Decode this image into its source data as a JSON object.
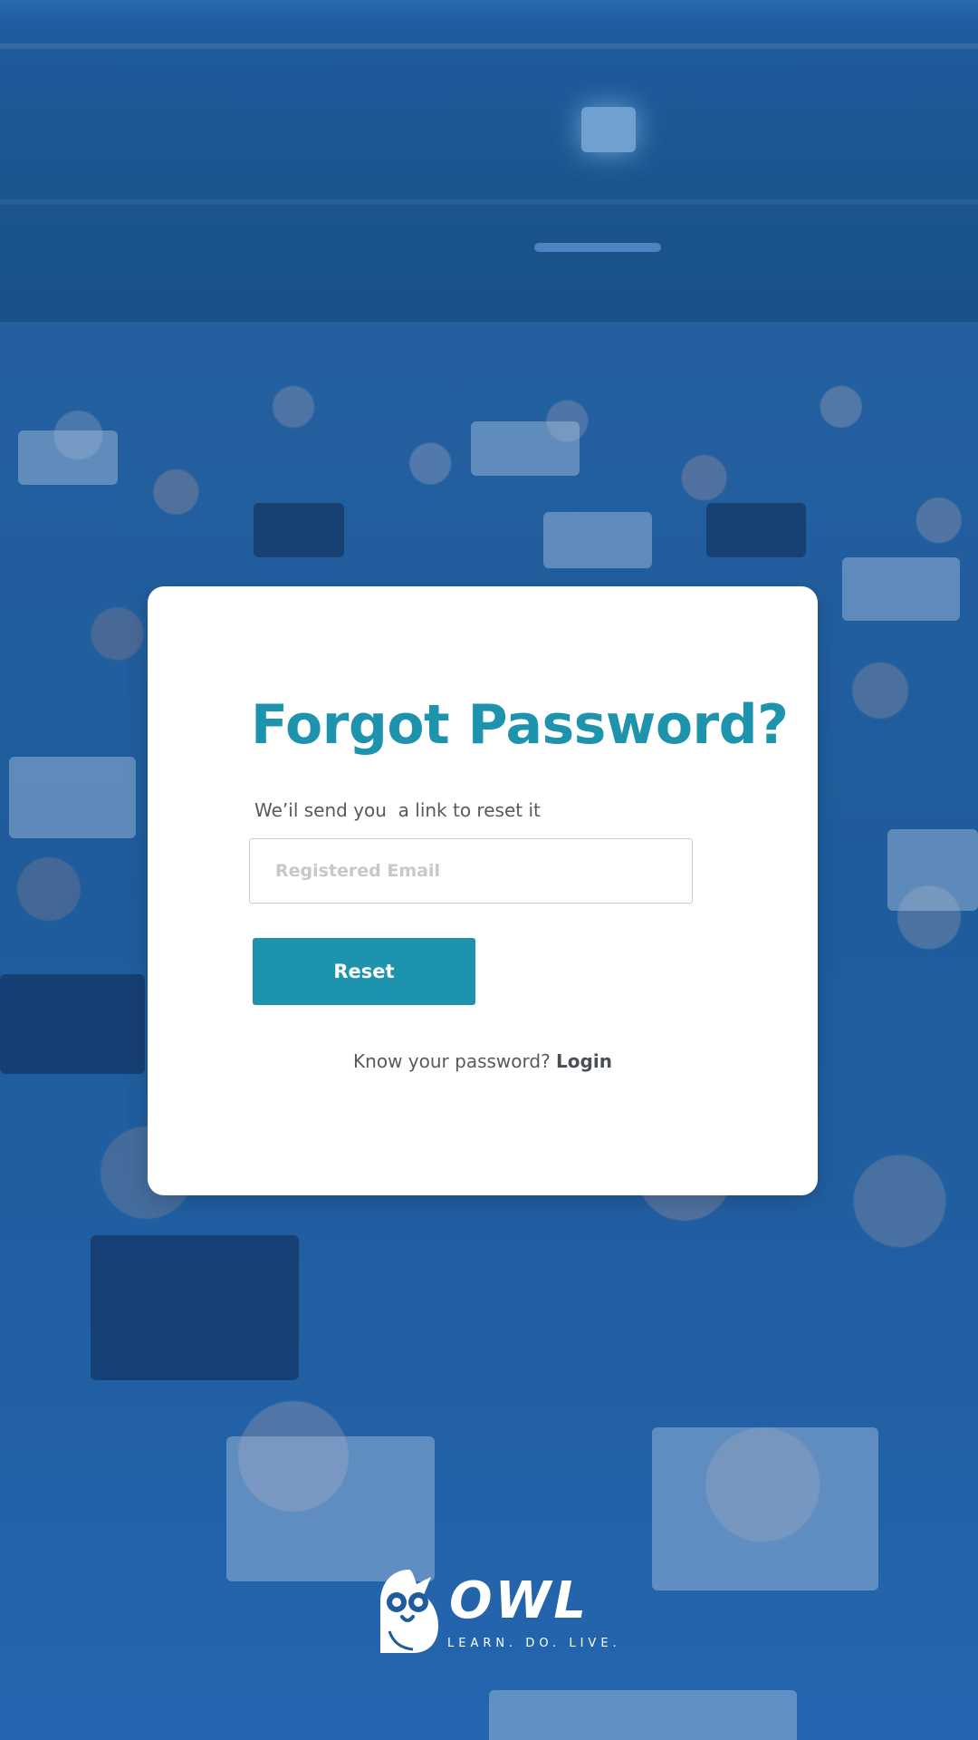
{
  "card": {
    "title": "Forgot Password?",
    "subtitle": "We’il send you  a link to reset it",
    "email_placeholder": "Registered Email",
    "email_value": "",
    "reset_label": "Reset",
    "login_prompt": "Know your password?",
    "login_label": "Login"
  },
  "brand": {
    "name": "OWL",
    "tagline": "LEARN. DO. LIVE.",
    "logo_icon": "owl-icon"
  },
  "colors": {
    "accent": "#1e93ad",
    "background_overlay": "#1f5c9e",
    "card": "#ffffff",
    "body_text": "#555a60"
  }
}
